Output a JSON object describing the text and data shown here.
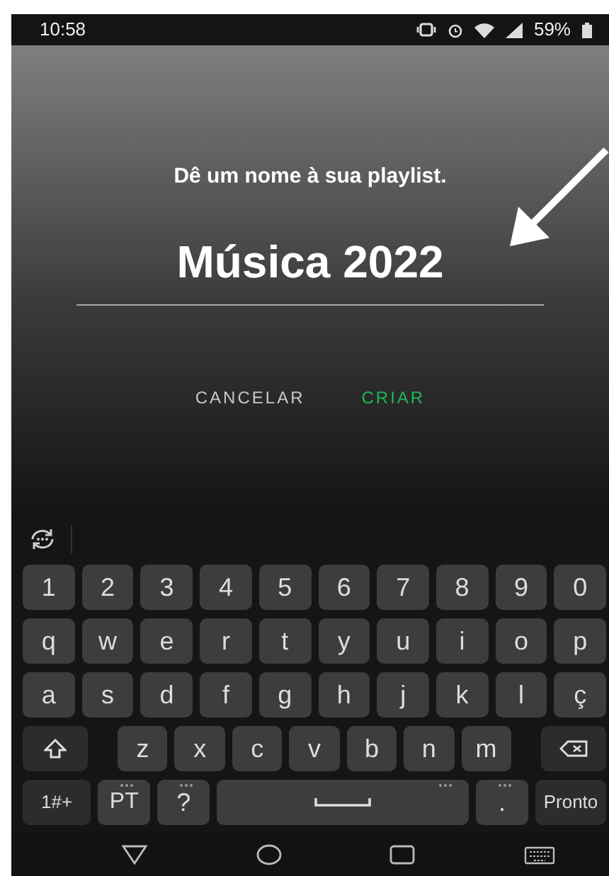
{
  "status_bar": {
    "time": "10:58",
    "battery": "59%"
  },
  "dialog": {
    "title": "Dê um nome à sua playlist.",
    "input": {
      "value": "Música 2022"
    },
    "buttons": [
      {
        "label": "CANCELAR",
        "kind": "secondary"
      },
      {
        "label": "CRIAR",
        "kind": "primary"
      }
    ]
  },
  "keyboard": {
    "rows": [
      {
        "keys": [
          {
            "label": "1",
            "kind": "char"
          },
          {
            "label": "2",
            "kind": "char"
          },
          {
            "label": "3",
            "kind": "char"
          },
          {
            "label": "4",
            "kind": "char"
          },
          {
            "label": "5",
            "kind": "char"
          },
          {
            "label": "6",
            "kind": "char"
          },
          {
            "label": "7",
            "kind": "char"
          },
          {
            "label": "8",
            "kind": "char"
          },
          {
            "label": "9",
            "kind": "char"
          },
          {
            "label": "0",
            "kind": "char"
          }
        ]
      },
      {
        "keys": [
          {
            "label": "q",
            "kind": "char"
          },
          {
            "label": "w",
            "kind": "char"
          },
          {
            "label": "e",
            "kind": "char"
          },
          {
            "label": "r",
            "kind": "char"
          },
          {
            "label": "t",
            "kind": "char"
          },
          {
            "label": "y",
            "kind": "char"
          },
          {
            "label": "u",
            "kind": "char"
          },
          {
            "label": "i",
            "kind": "char"
          },
          {
            "label": "o",
            "kind": "char"
          },
          {
            "label": "p",
            "kind": "char"
          }
        ]
      },
      {
        "keys": [
          {
            "label": "a",
            "kind": "char"
          },
          {
            "label": "s",
            "kind": "char"
          },
          {
            "label": "d",
            "kind": "char"
          },
          {
            "label": "f",
            "kind": "char"
          },
          {
            "label": "g",
            "kind": "char"
          },
          {
            "label": "h",
            "kind": "char"
          },
          {
            "label": "j",
            "kind": "char"
          },
          {
            "label": "k",
            "kind": "char"
          },
          {
            "label": "l",
            "kind": "char"
          },
          {
            "label": "ç",
            "kind": "char"
          }
        ]
      },
      {
        "keys": [
          {
            "kind": "shift"
          },
          {
            "label": "z",
            "kind": "char"
          },
          {
            "label": "x",
            "kind": "char"
          },
          {
            "label": "c",
            "kind": "char"
          },
          {
            "label": "v",
            "kind": "char"
          },
          {
            "label": "b",
            "kind": "char"
          },
          {
            "label": "n",
            "kind": "char"
          },
          {
            "label": "m",
            "kind": "char"
          },
          {
            "kind": "backspace"
          }
        ]
      },
      {
        "keys": [
          {
            "label": "1#+",
            "kind": "mode"
          },
          {
            "label": "PT",
            "kind": "char",
            "more": true
          },
          {
            "label": "?",
            "kind": "char",
            "more": true
          },
          {
            "kind": "space",
            "more": true
          },
          {
            "label": ".",
            "kind": "char",
            "more": true
          },
          {
            "label": "Pronto",
            "kind": "action"
          }
        ]
      }
    ]
  }
}
